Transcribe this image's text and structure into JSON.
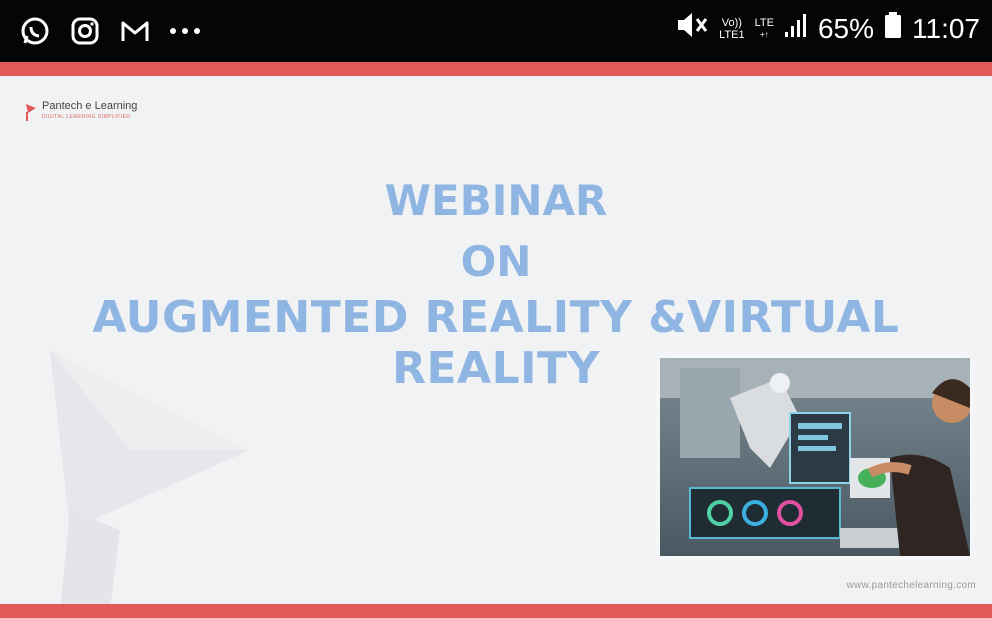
{
  "status_bar": {
    "left_icons": [
      "whatsapp-icon",
      "instagram-icon",
      "gmail-icon",
      "more-icon"
    ],
    "volte_top": "Vo))",
    "volte_bottom": "LTE1",
    "lte_top": "LTE",
    "lte_bottom": "+↑",
    "battery_percent": "65%",
    "time": "11:07"
  },
  "slide": {
    "logo_name": "Pantech e Learning",
    "logo_tagline": "DIGITAL LEARNING SIMPLIFIED",
    "title_line1": "WEBINAR",
    "title_line2": "ON",
    "title_line3": "AUGMENTED REALITY &VIRTUAL REALITY",
    "website": "www.pantechelearning.com"
  },
  "colors": {
    "accent_red": "#e15a59",
    "title_blue": "#8fb5e3"
  }
}
